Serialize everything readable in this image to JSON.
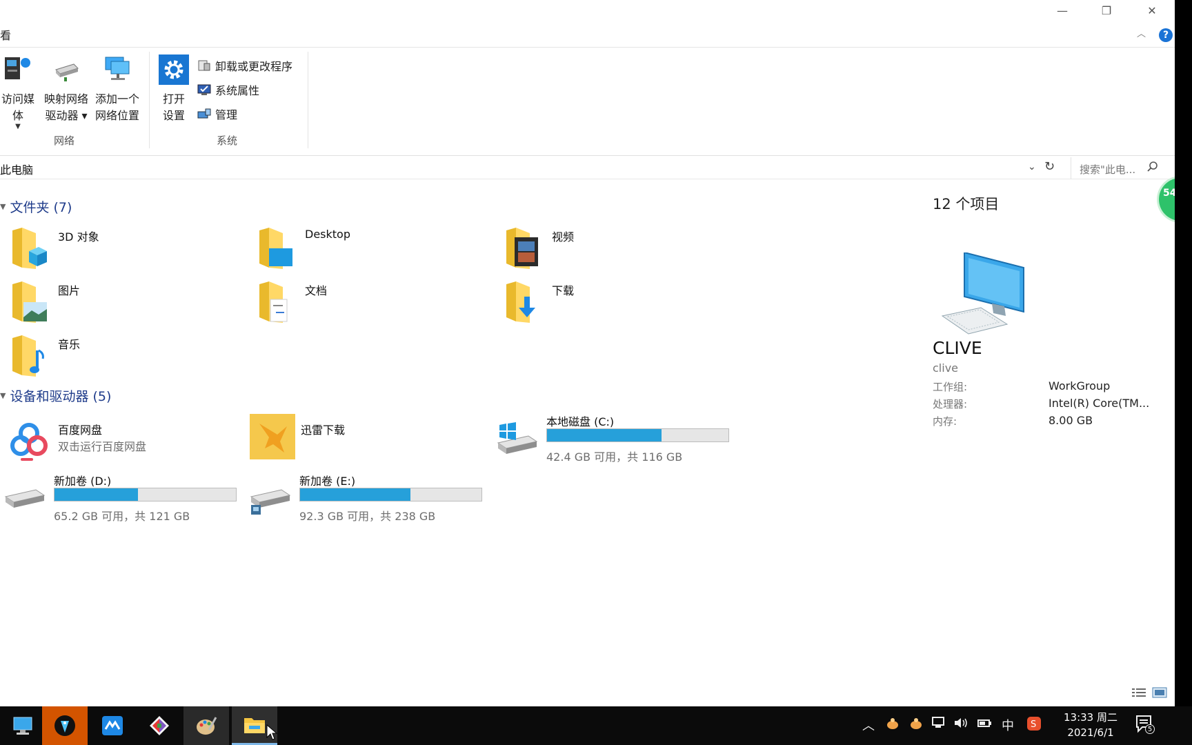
{
  "window": {
    "ribbon_tab": "看",
    "buttons": {
      "minimize": "—",
      "restore": "❐",
      "close": "✕"
    }
  },
  "ribbon": {
    "media_label": "访问媒体",
    "map_drive_line1": "映射网络",
    "map_drive_line2": "驱动器 ▾",
    "add_location_line1": "添加一个",
    "add_location_line2": "网络位置",
    "network_group": "网络",
    "open_settings_line1": "打开",
    "open_settings_line2": "设置",
    "uninstall": "卸载或更改程序",
    "system_properties": "系统属性",
    "manage": "管理",
    "system_group": "系统"
  },
  "address": {
    "path": "此电脑",
    "search_placeholder": "搜索\"此电..."
  },
  "float_badge": "54",
  "folders": {
    "header": "文件夹 (7)",
    "items": [
      {
        "name": "3D 对象",
        "icon": "3d-objects-folder-icon"
      },
      {
        "name": "Desktop",
        "icon": "desktop-folder-icon"
      },
      {
        "name": "视频",
        "icon": "videos-folder-icon"
      },
      {
        "name": "图片",
        "icon": "pictures-folder-icon"
      },
      {
        "name": "文档",
        "icon": "documents-folder-icon"
      },
      {
        "name": "下载",
        "icon": "downloads-folder-icon"
      },
      {
        "name": "音乐",
        "icon": "music-folder-icon"
      }
    ]
  },
  "devices": {
    "header": "设备和驱动器 (5)",
    "baidu": {
      "name": "百度网盘",
      "sub": "双击运行百度网盘"
    },
    "xunlei": {
      "name": "迅雷下载"
    },
    "drives": [
      {
        "name": "本地磁盘 (C:)",
        "free": "42.4 GB 可用，共 116 GB",
        "used_fraction": 0.63
      },
      {
        "name": "新加卷 (D:)",
        "free": "65.2 GB 可用，共 121 GB",
        "used_fraction": 0.46
      },
      {
        "name": "新加卷 (E:)",
        "free": "92.3 GB 可用，共 238 GB",
        "used_fraction": 0.61
      }
    ]
  },
  "details": {
    "count": "12 个项目",
    "computer_name": "CLIVE",
    "user": "clive",
    "props": [
      {
        "key": "工作组:",
        "value": "WorkGroup"
      },
      {
        "key": "处理器:",
        "value": "Intel(R) Core(TM..."
      },
      {
        "key": "内存:",
        "value": "8.00 GB"
      }
    ]
  },
  "taskbar": {
    "apps": [
      "this-pc-icon",
      "tablet-app-icon",
      "mail-app-icon",
      "code-app-icon",
      "paint-app-icon",
      "file-explorer-icon"
    ],
    "tray_ime": "中",
    "time": "13:33 周二",
    "date": "2021/6/1",
    "notification_count": "5"
  },
  "colors": {
    "drive_fill": "#26a0da",
    "section_header": "#1e3b8a",
    "taskbar": "#0b0b0b",
    "active_app": "#d35400"
  }
}
